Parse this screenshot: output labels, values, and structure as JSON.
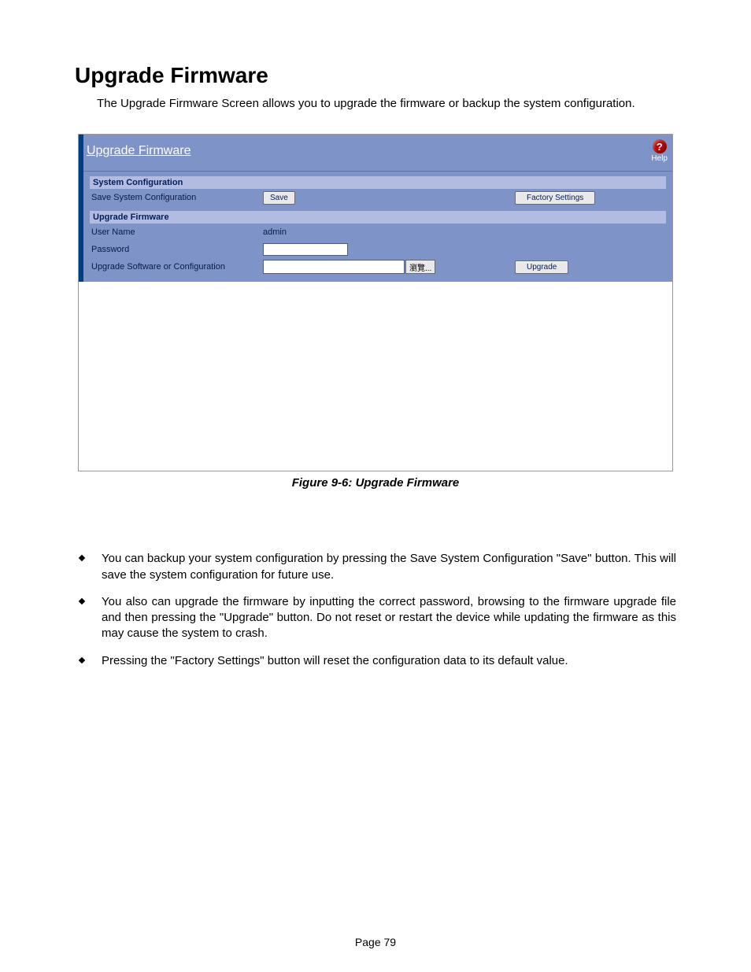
{
  "doc": {
    "title": "Upgrade Firmware",
    "intro": "The Upgrade Firmware Screen allows you to upgrade the firmware or backup the system configuration."
  },
  "panel": {
    "title": "Upgrade Firmware",
    "help_label": "Help",
    "sections": {
      "sysconf": {
        "header": "System Configuration",
        "save_row_label": "Save System Configuration",
        "save_button": "Save",
        "factory_button": "Factory Settings"
      },
      "upgrade": {
        "header": "Upgrade Firmware",
        "user_label": "User Name",
        "user_value": "admin",
        "password_label": "Password",
        "password_value": "",
        "file_label": "Upgrade Software or Configuration",
        "browse_button": "瀏覽...",
        "upgrade_button": "Upgrade"
      }
    }
  },
  "figure_caption": "Figure 9-6: Upgrade Firmware",
  "notes": [
    "You can backup your system configuration by pressing the Save System Configuration \"Save\" button. This will save the system configuration for future use.",
    " You also can upgrade the firmware by inputting the correct password, browsing to the firmware upgrade file and then pressing the \"Upgrade\" button. Do not reset or restart the device while updating the firmware as this may cause the system to crash.",
    "Pressing the \"Factory Settings\" button will reset the configuration data to its default value."
  ],
  "footer": "Page 79"
}
